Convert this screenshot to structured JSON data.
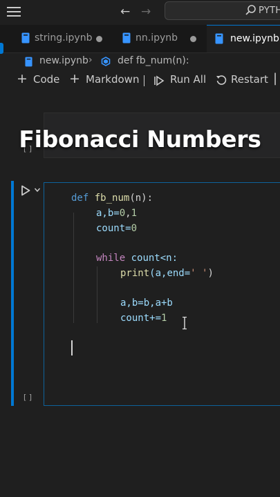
{
  "search": {
    "text": "PYTH"
  },
  "tabs": [
    {
      "label": "string.ipynb",
      "modified": true
    },
    {
      "label": "nn.ipynb",
      "modified": true
    },
    {
      "label": "new.ipynb",
      "active": true
    }
  ],
  "breadcrumb": {
    "file": "new.ipynb",
    "symbol": "def fb_num(n):"
  },
  "toolbar": {
    "code": "Code",
    "markdown": "Markdown",
    "run_all": "Run All",
    "restart": "Restart"
  },
  "cells": {
    "bracket": "[ ]"
  },
  "overlay": {
    "title": "Fibonacci Numbers"
  },
  "code": {
    "l1": {
      "kw": "def",
      "fn": "fb_num",
      "rest": "(n):"
    },
    "l2": {
      "a": "a,b=",
      "n1": "0",
      "c": ",",
      "n2": "1"
    },
    "l3": {
      "a": "count=",
      "n": "0"
    },
    "l4": {
      "kw": "while",
      "rest": " count<n:"
    },
    "l5": {
      "fn": "print",
      "a": "(a,end=",
      "s": "' '",
      "b": ")"
    },
    "l6": {
      "a": "a,b=b,a+b"
    },
    "l7": {
      "a": "count+=",
      "n": "1"
    }
  },
  "colors": {
    "accent": "#0078d4",
    "keyword": "#569cd6",
    "control": "#c586c0",
    "function": "#dcdcaa",
    "number": "#b5cea8",
    "string": "#ce9178",
    "variable": "#9cdcfe"
  }
}
